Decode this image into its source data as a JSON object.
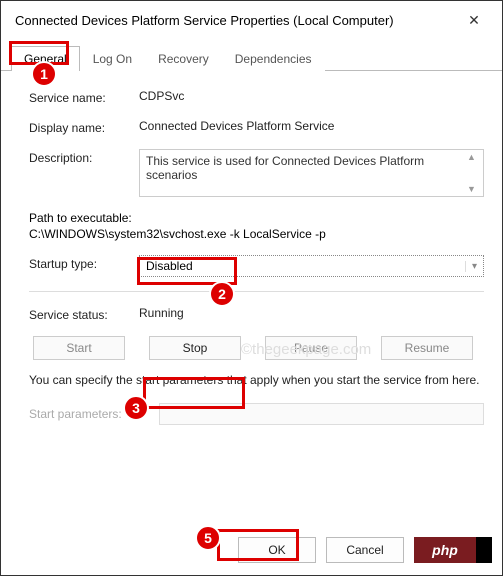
{
  "title": "Connected Devices Platform Service Properties (Local Computer)",
  "tabs": {
    "general": "General",
    "logon": "Log On",
    "recovery": "Recovery",
    "dependencies": "Dependencies"
  },
  "labels": {
    "service_name": "Service name:",
    "display_name": "Display name:",
    "description": "Description:",
    "path_label": "Path to executable:",
    "startup_type": "Startup type:",
    "service_status": "Service status:",
    "start_params": "Start parameters:"
  },
  "values": {
    "service_name": "CDPSvc",
    "display_name": "Connected Devices Platform Service",
    "description": "This service is used for Connected Devices Platform scenarios",
    "path": "C:\\WINDOWS\\system32\\svchost.exe -k LocalService -p",
    "startup_type": "Disabled",
    "service_status": "Running"
  },
  "buttons": {
    "start": "Start",
    "stop": "Stop",
    "pause": "Pause",
    "resume": "Resume",
    "ok": "OK",
    "cancel": "Cancel"
  },
  "note": "You can specify the start parameters that apply when you start the service from here.",
  "watermark": "©thegeekpage.com",
  "php": "php",
  "annotations": {
    "m1": "1",
    "m2": "2",
    "m3": "3",
    "m5": "5"
  }
}
